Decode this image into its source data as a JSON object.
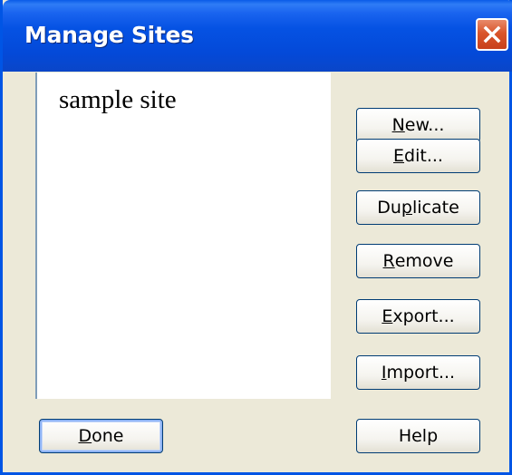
{
  "window": {
    "title": "Manage Sites"
  },
  "sites": {
    "items": [
      "sample site"
    ]
  },
  "buttons": {
    "new": {
      "pre": "",
      "key": "N",
      "post": "ew..."
    },
    "edit": {
      "pre": "",
      "key": "E",
      "post": "dit..."
    },
    "duplicate": {
      "pre": "Du",
      "key": "p",
      "post": "licate"
    },
    "remove": {
      "pre": "",
      "key": "R",
      "post": "emove"
    },
    "export": {
      "pre": "",
      "key": "E",
      "post": "xport..."
    },
    "import": {
      "pre": "",
      "key": "I",
      "post": "mport..."
    },
    "done": {
      "pre": "",
      "key": "D",
      "post": "one"
    },
    "help": {
      "pre": "",
      "key": "",
      "post": "Help"
    }
  },
  "icons": {
    "close": "close-icon"
  },
  "colors": {
    "titlebar": "#0552e3",
    "close": "#d9552b",
    "face": "#ece9d8",
    "button_border": "#003c74"
  }
}
